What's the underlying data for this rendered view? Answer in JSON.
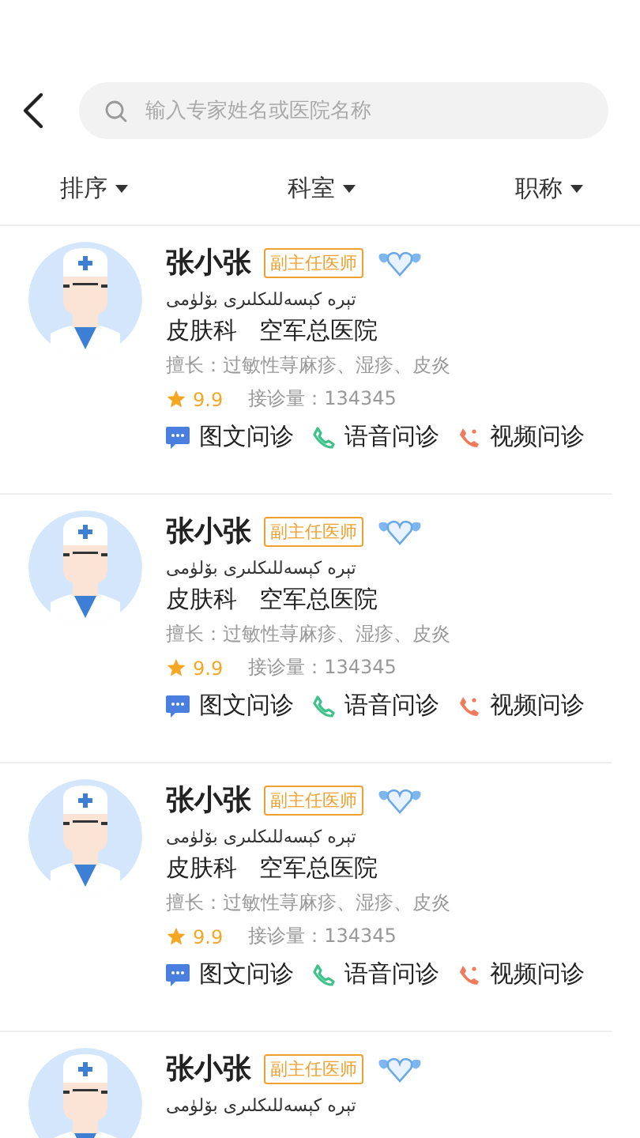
{
  "search": {
    "placeholder": "输入专家姓名或医院名称"
  },
  "filters": [
    {
      "label": "排序"
    },
    {
      "label": "科室"
    },
    {
      "label": "职称"
    }
  ],
  "doctors": [
    {
      "name": "张小张",
      "title": "副主任医师",
      "subtitle": "تېرە كېسەللىكلىرى بۆلۈمى",
      "department": "皮肤科",
      "hospital": "空军总医院",
      "specialty": "擅长：过敏性荨麻疹、湿疹、皮炎",
      "rating": "9.9",
      "consultations": "接诊量：134345",
      "services": [
        {
          "kind": "text",
          "label": "图文问诊"
        },
        {
          "kind": "voice",
          "label": "语音问诊"
        },
        {
          "kind": "video",
          "label": "视频问诊"
        }
      ]
    },
    {
      "name": "张小张",
      "title": "副主任医师",
      "subtitle": "تېرە كېسەللىكلىرى بۆلۈمى",
      "department": "皮肤科",
      "hospital": "空军总医院",
      "specialty": "擅长：过敏性荨麻疹、湿疹、皮炎",
      "rating": "9.9",
      "consultations": "接诊量：134345",
      "services": [
        {
          "kind": "text",
          "label": "图文问诊"
        },
        {
          "kind": "voice",
          "label": "语音问诊"
        },
        {
          "kind": "video",
          "label": "视频问诊"
        }
      ]
    },
    {
      "name": "张小张",
      "title": "副主任医师",
      "subtitle": "تېرە كېسەللىكلىرى بۆلۈمى",
      "department": "皮肤科",
      "hospital": "空军总医院",
      "specialty": "擅长：过敏性荨麻疹、湿疹、皮炎",
      "rating": "9.9",
      "consultations": "接诊量：134345",
      "services": [
        {
          "kind": "text",
          "label": "图文问诊"
        },
        {
          "kind": "voice",
          "label": "语音问诊"
        },
        {
          "kind": "video",
          "label": "视频问诊"
        }
      ]
    },
    {
      "name": "张小张",
      "title": "副主任医师",
      "subtitle": "تېرە كېسەللىكلىرى بۆلۈمى"
    }
  ]
}
